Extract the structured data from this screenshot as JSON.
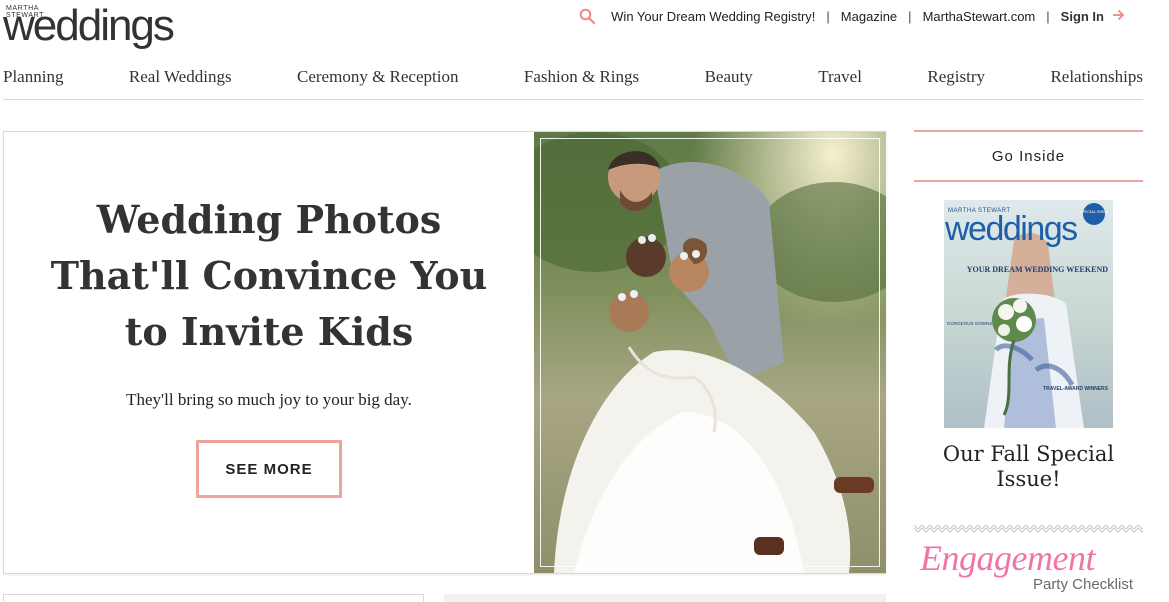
{
  "brand": {
    "tagline": "MARTHA STEWART",
    "name": "weddings"
  },
  "utility": {
    "promo_link": "Win Your Dream Wedding Registry!",
    "magazine_link": "Magazine",
    "site_link": "MarthaStewart.com",
    "signin_label": "Sign In",
    "accent_color": "#f08880"
  },
  "nav": {
    "items": [
      {
        "label": "Planning"
      },
      {
        "label": "Real Weddings"
      },
      {
        "label": "Ceremony & Reception"
      },
      {
        "label": "Fashion & Rings"
      },
      {
        "label": "Beauty"
      },
      {
        "label": "Travel"
      },
      {
        "label": "Registry"
      },
      {
        "label": "Relationships"
      }
    ]
  },
  "hero": {
    "title": "Wedding Photos That'll Convince You to Invite Kids",
    "subtitle": "They'll bring so much joy to your big day.",
    "cta_label": "SEE MORE",
    "cta_border_color": "#eca59d"
  },
  "sidebar": {
    "section_title": "Go Inside",
    "magazine_cover": {
      "masthead_top": "MARTHA STEWART",
      "masthead": "weddings",
      "badge": "SPECIAL ISSUE",
      "headline": "YOUR DREAM WEDDING WEEKEND",
      "side_text_1": "GORGEOUS GOWNS",
      "side_text_2": "TRAVEL-AWARD WINNERS"
    },
    "caption": "Our Fall Special Issue!",
    "ad": {
      "title": "Engagement",
      "subtitle": "Party Checklist",
      "title_color": "#ef74a8"
    }
  }
}
